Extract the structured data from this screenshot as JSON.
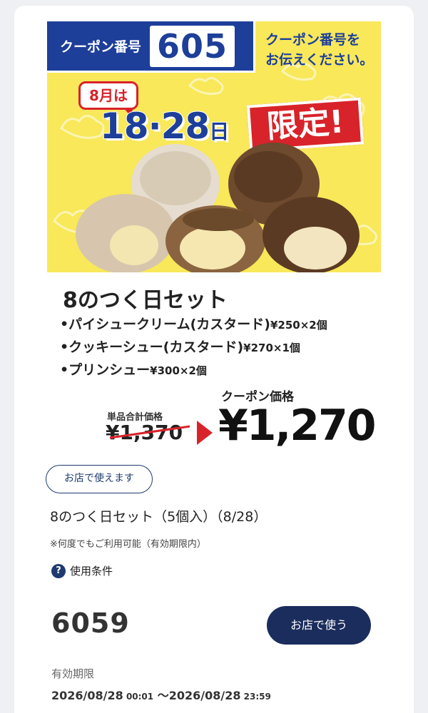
{
  "banner": {
    "coupon_label": "クーポン番号",
    "coupon_number": "605",
    "tell_line1": "クーポン番号を",
    "tell_line2": "お伝えください。",
    "month_badge": "8月は",
    "date_a": "18",
    "date_sep": "·",
    "date_b": "28",
    "date_suffix": "日",
    "limited": "限定!"
  },
  "product": {
    "title": "8のつく日セット",
    "items": [
      {
        "name": "•パイシュークリーム(カスタード)",
        "price": "¥250×2個"
      },
      {
        "name": "•クッキーシュー(カスタード)",
        "price": "¥270×1個"
      },
      {
        "name": "•プリンシュー",
        "price": "¥300×2個"
      }
    ],
    "sum_label": "単品合計価格",
    "original_price": "¥1,370",
    "coupon_price_label": "クーポン価格",
    "coupon_price": "¥1,270"
  },
  "coupon": {
    "store_badge": "お店で使えます",
    "name": "8のつく日セット（5個入）（8/28）",
    "note": "※何度でもご利用可能（有効期限内）",
    "conditions_icon": "?",
    "conditions_label": "使用条件",
    "code": "6059",
    "use_button": "お店で使う",
    "expiry_label": "有効期限",
    "expiry_start_date": "2026/08/28",
    "expiry_start_time": "00:01",
    "expiry_sep": " ～",
    "expiry_end_date": "2026/08/28",
    "expiry_end_time": "23:59"
  },
  "colors": {
    "navy": "#1b2d5c",
    "banner_blue": "#1d3f9a",
    "banner_yellow": "#f8e85a",
    "accent_red": "#d8232a"
  },
  "icons": {
    "conditions": "question-circle-icon",
    "arrow": "triangle-right-icon"
  }
}
